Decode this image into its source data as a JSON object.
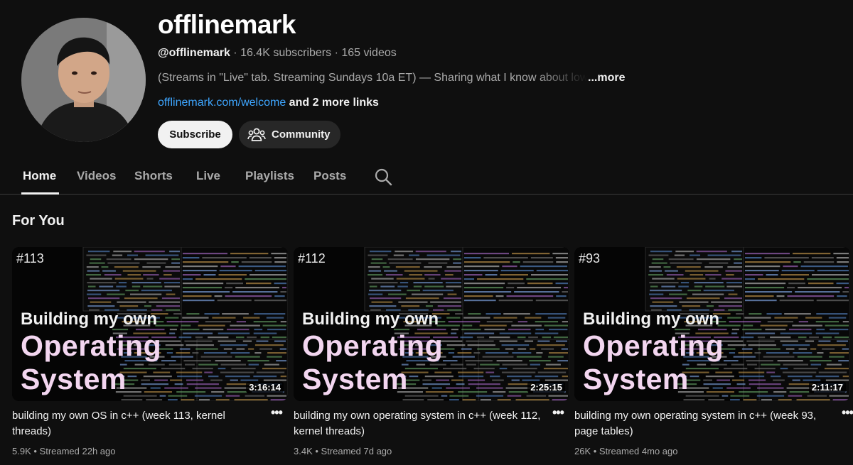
{
  "channel": {
    "name": "offlinemark",
    "handle": "@offlinemark",
    "subscribers": "16.4K subscribers",
    "videos": "165 videos",
    "separator": " · ",
    "description": "(Streams in \"Live\" tab. Streaming Sundays 10a ET) — Sharing what I know about low level",
    "more_label": "...more",
    "link": "offlinemark.com/welcome",
    "more_links": "and 2 more links"
  },
  "buttons": {
    "subscribe": "Subscribe",
    "community": "Community"
  },
  "tabs": [
    "Home",
    "Videos",
    "Shorts",
    "Live",
    "Playlists",
    "Posts"
  ],
  "active_tab": "Home",
  "section_title": "For You",
  "videos": [
    {
      "episode": "#113",
      "thumb_line1": "Building my own",
      "thumb_line2": "Operating",
      "thumb_line3": "System",
      "duration": "3:16:14",
      "title": "building my own OS in c++ (week 113, kernel threads)",
      "views": "5.9K",
      "streamed": "Streamed 22h ago"
    },
    {
      "episode": "#112",
      "thumb_line1": "Building my own",
      "thumb_line2": "Operating",
      "thumb_line3": "System",
      "duration": "2:25:15",
      "title": "building my own operating system in c++ (week 112, kernel threads)",
      "views": "3.4K",
      "streamed": "Streamed 7d ago"
    },
    {
      "episode": "#93",
      "thumb_line1": "Building my own",
      "thumb_line2": "Operating",
      "thumb_line3": "System",
      "duration": "2:11:17",
      "title": "building my own operating system in c++ (week 93, page tables)",
      "views": "26K",
      "streamed": "Streamed 4mo ago"
    }
  ],
  "menu_glyph": "•••",
  "meta_separator": " • ",
  "colors": {
    "background": "#0f0f0f",
    "link": "#3ea6ff",
    "thumb_title_accent": "#f3d6f0",
    "chip_background": "#272727"
  },
  "icons": [
    "avatar-photo",
    "community-people-icon",
    "search-icon",
    "more-options-icon"
  ]
}
